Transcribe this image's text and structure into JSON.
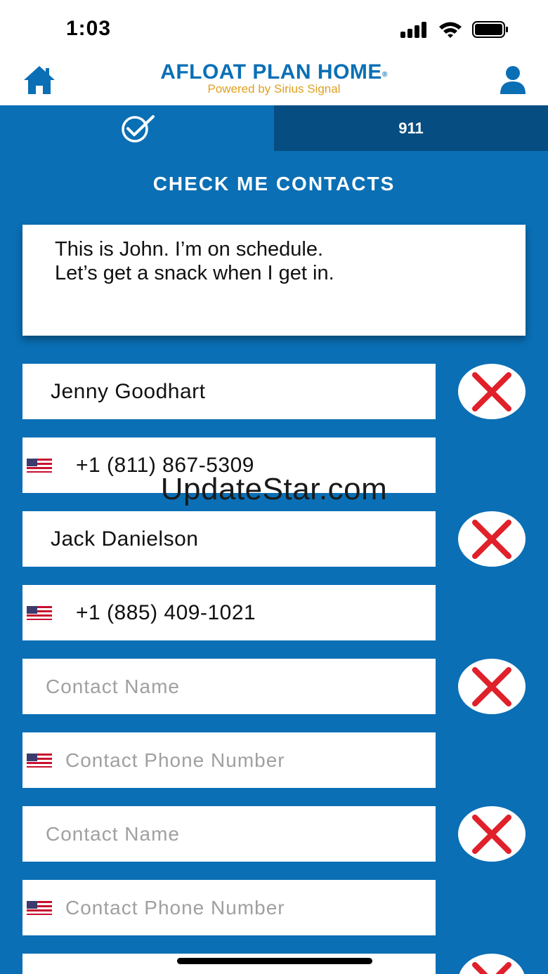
{
  "status_bar": {
    "time": "1:03"
  },
  "header": {
    "brand_title": "AFLOAT PLAN HOME",
    "brand_mark": "®",
    "brand_subtitle": "Powered by Sirius Signal",
    "home_icon": "home-icon",
    "profile_icon": "user-icon"
  },
  "tabs": {
    "check_icon": "check-circle-icon",
    "emergency_label": "911"
  },
  "section_title": "CHECK ME CONTACTS",
  "message": "This is John. I’m on schedule.\nLet’s get a snack when I get in.",
  "contacts": [
    {
      "name": "Jenny Goodhart",
      "phone": "+1 (811) 867-5309"
    },
    {
      "name": "Jack Danielson",
      "phone": "+1 (885) 409-1021"
    },
    {
      "name": "",
      "phone": ""
    },
    {
      "name": "",
      "phone": ""
    },
    {
      "name": "",
      "phone": ""
    }
  ],
  "placeholders": {
    "name": "Contact Name",
    "phone": "Contact Phone Number"
  },
  "watermark": "UpdateStar.com",
  "colors": {
    "primary": "#0a6fb5",
    "tab_dark": "#064d82",
    "accent": "#e0a020",
    "remove_x": "#e0202a"
  }
}
